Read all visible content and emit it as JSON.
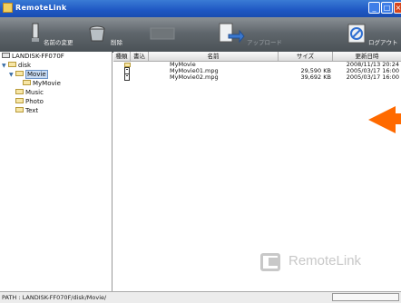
{
  "window": {
    "title": "RemoteLink"
  },
  "toolbar": {
    "rename_label": "名前の変更",
    "delete_label": "削除",
    "upload_label": "アップロード",
    "logout_label": "ログアウト"
  },
  "tree": {
    "root": "LANDISK-FF070F",
    "items": [
      {
        "label": "disk"
      },
      {
        "label": "Movie"
      },
      {
        "label": "MyMovie"
      },
      {
        "label": "Music"
      },
      {
        "label": "Photo"
      },
      {
        "label": "Text"
      }
    ]
  },
  "table": {
    "headers": [
      "種類",
      "書込",
      "名前",
      "サイズ",
      "更新日時"
    ],
    "rows": [
      {
        "type": "folder-icon",
        "name": "MyMovie",
        "size": "",
        "date": "2008/11/13 20:24"
      },
      {
        "type": "video-file-icon",
        "name": "MyMovie01.mpg",
        "size": "29,590 KB",
        "date": "2005/03/17 16:00"
      },
      {
        "type": "video-file-icon",
        "name": "MyMovie02.mpg",
        "size": "39,692 KB",
        "date": "2005/03/17 16:00"
      }
    ]
  },
  "watermark": {
    "text": "RemoteLink"
  },
  "status": {
    "path": "PATH : LANDISK-FF070F/disk/Movie/"
  },
  "colors": {
    "arrow": "#ff6a00",
    "titlebar": "#1f57c3"
  }
}
